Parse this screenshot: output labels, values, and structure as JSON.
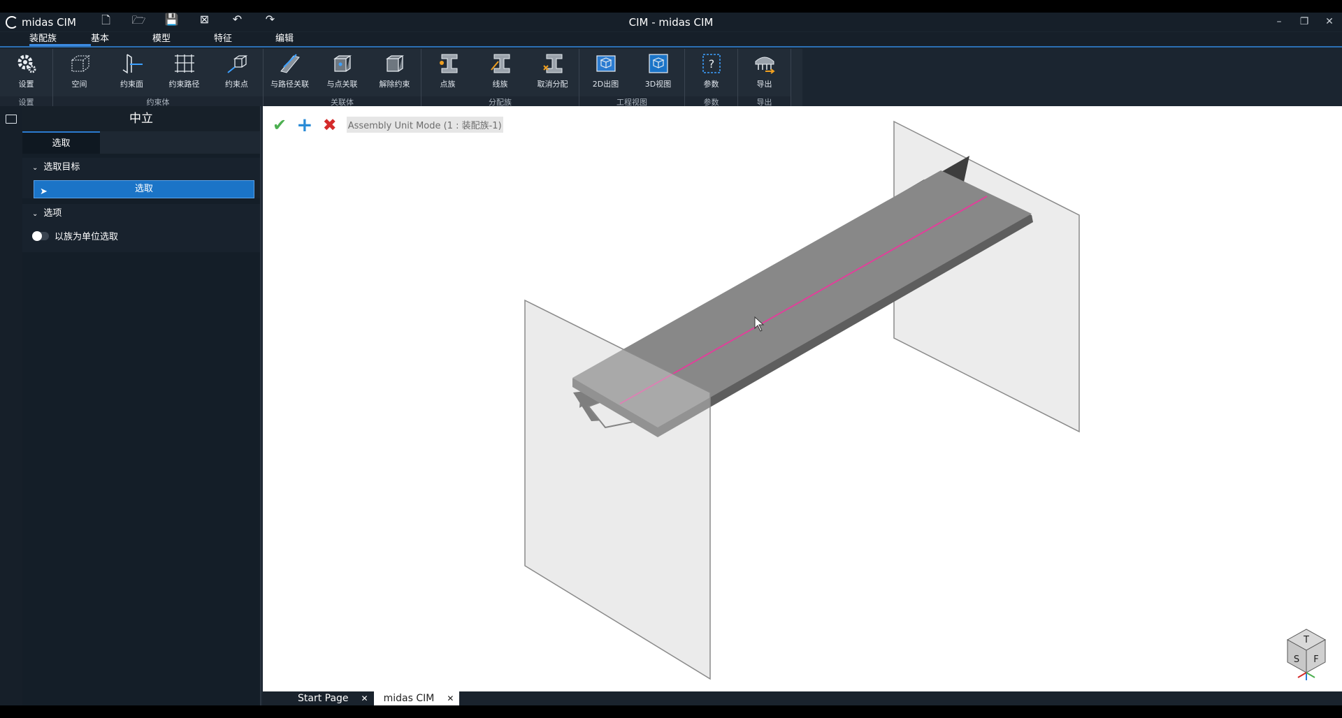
{
  "app": {
    "logo_text": "midas CIM",
    "window_title": "CIM - midas CIM",
    "quick_access_icons": [
      "new-file-icon",
      "open-folder-icon",
      "save-icon",
      "close-file-icon",
      "undo-icon",
      "redo-icon"
    ],
    "window_controls": [
      "minimize-icon",
      "restore-icon",
      "close-icon"
    ]
  },
  "menu": {
    "items": [
      "装配族",
      "基本",
      "模型",
      "特征",
      "编辑"
    ],
    "active": "装配族"
  },
  "ribbon": {
    "groups": [
      {
        "label": "设置",
        "buttons": [
          {
            "label": "设置",
            "icon": "gear-icon"
          }
        ]
      },
      {
        "label": "约束体",
        "buttons": [
          {
            "label": "空间",
            "icon": "space-icon"
          },
          {
            "label": "约束面",
            "icon": "constraint-plane-icon"
          },
          {
            "label": "约束路径",
            "icon": "constraint-path-icon"
          },
          {
            "label": "约束点",
            "icon": "constraint-point-icon"
          }
        ]
      },
      {
        "label": "关联体",
        "buttons": [
          {
            "label": "与路径关联",
            "icon": "path-link-icon"
          },
          {
            "label": "与点关联",
            "icon": "point-link-icon"
          },
          {
            "label": "解除约束",
            "icon": "release-constraint-icon"
          }
        ]
      },
      {
        "label": "分配族",
        "buttons": [
          {
            "label": "点族",
            "icon": "point-family-icon"
          },
          {
            "label": "线族",
            "icon": "line-family-icon"
          },
          {
            "label": "取消分配",
            "icon": "unassign-icon"
          }
        ]
      },
      {
        "label": "工程视图",
        "buttons": [
          {
            "label": "2D出图",
            "icon": "drawing-2d-icon"
          },
          {
            "label": "3D视图",
            "icon": "view-3d-icon"
          }
        ]
      },
      {
        "label": "参数",
        "buttons": [
          {
            "label": "参数",
            "icon": "parameter-icon"
          }
        ]
      },
      {
        "label": "导出",
        "buttons": [
          {
            "label": "导出",
            "icon": "export-icon"
          }
        ]
      }
    ]
  },
  "panel": {
    "title": "中立",
    "tab": "选取",
    "section_target": "选取目标",
    "select_button": "选取",
    "section_options": "选项",
    "toggle_label": "以族为单位选取"
  },
  "viewport": {
    "mode_text": "Assembly Unit Mode (1 : 装配族-1)",
    "nav_cube": {
      "top": "T",
      "left": "S",
      "right": "F"
    }
  },
  "doc_tabs": [
    {
      "label": "Start Page",
      "active": false
    },
    {
      "label": "midas CIM",
      "active": true
    }
  ],
  "colors": {
    "accent": "#1b74c7",
    "path_line": "#e0409a",
    "ok": "#4caf50",
    "add": "#2a8bd6",
    "cancel": "#d42b2b"
  }
}
